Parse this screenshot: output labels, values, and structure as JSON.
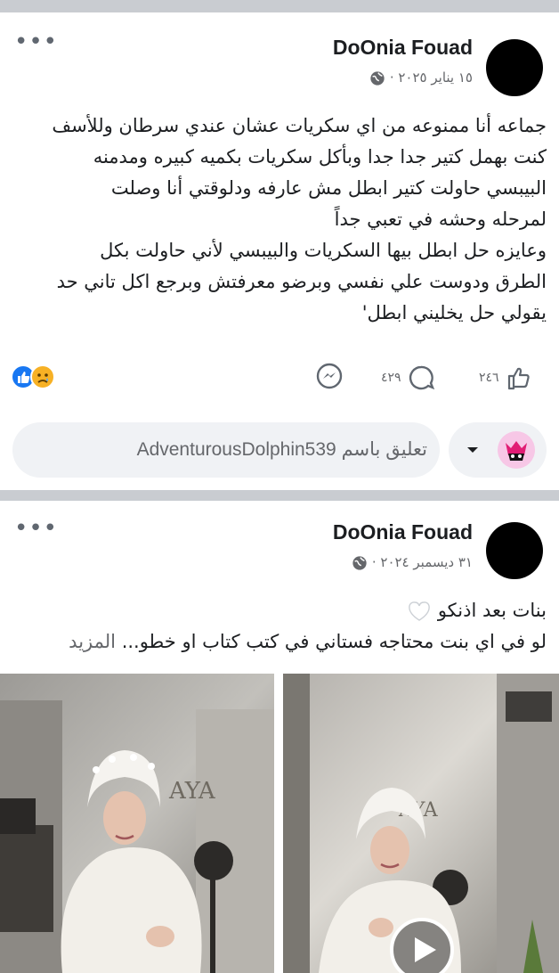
{
  "posts": [
    {
      "author": "DoOnia Fouad",
      "date": "١٥ يناير ٢٠٢٥ ·",
      "lines": [
        "جماعه أنا ممنوعه من اي سكريات عشان عندي سرطان وللأسف",
        "كنت بهمل كتير جدا جدا وبأكل سكريات بكميه كبيره ومدمنه",
        "البيبسي  حاولت كتير ابطل مش عارفه ودلوقتي أنا وصلت",
        "لمرحله وحشه في تعبي جداً",
        "وعايزه حل ابطل بيها السكريات والبيبسي لأني حاولت بكل",
        "الطرق ودوست علي نفسي وبرضو معرفتش وبرجع اكل تاني حد",
        "يقولي حل يخليني ابطل'"
      ],
      "likes": "٢٤٦",
      "comments": "٤٢٩",
      "comment_placeholder": "تعليق باسم AdventurousDolphin539"
    },
    {
      "author": "DoOnia Fouad",
      "date": "٣١ ديسمبر ٢٠٢٤ ·",
      "line1": "بنات بعد اذنكو",
      "line2_main": "لو في اي بنت محتاجه فستاني في كتب كتاب او خطو...",
      "line2_more": "المزيد"
    }
  ],
  "icons": [
    "more-dots-icon",
    "globe-icon",
    "like-icon",
    "sad-icon",
    "messenger-icon",
    "comment-icon",
    "thumbs-up-icon",
    "dropdown-icon",
    "play-icon",
    "white-heart-icon"
  ],
  "colors": {
    "like_blue": "#1877f2",
    "sad_yellow": "#f7b125",
    "meta_gray": "#65676b",
    "separator": "#c9ccd1",
    "comment_bg": "#f0f2f5"
  }
}
